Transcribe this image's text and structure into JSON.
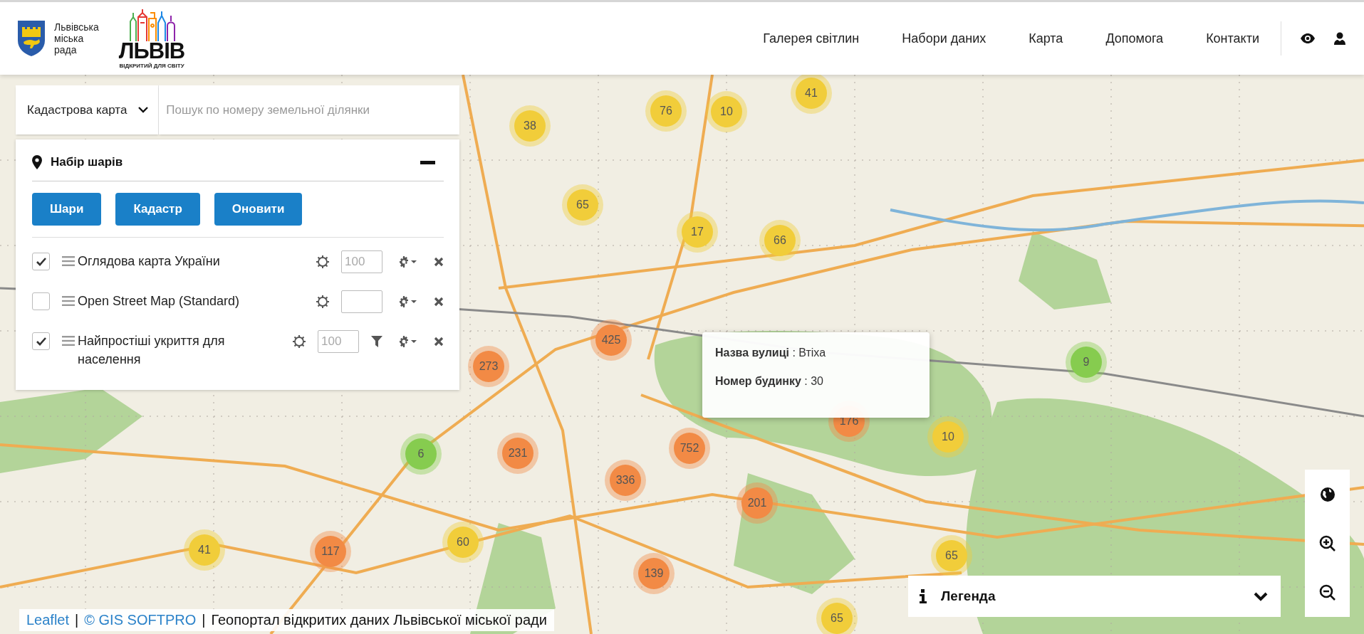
{
  "header": {
    "council": "Львівська міська рада",
    "brand": {
      "name": "ЛЬВІВ",
      "tagline": "ВІДКРИТИЙ ДЛЯ СВІТУ"
    },
    "nav": [
      "Галерея світлин",
      "Набори даних",
      "Карта",
      "Допомога",
      "Контакти"
    ]
  },
  "search": {
    "layer_select": "Кадастрова карта",
    "placeholder": "Пошук по номеру земельної ділянки"
  },
  "layers_panel": {
    "title": "Набір шарів",
    "buttons": [
      "Шари",
      "Кадастр",
      "Оновити"
    ],
    "layers": [
      {
        "name": "Оглядова карта України",
        "checked": true,
        "opacity": "100",
        "filter": false
      },
      {
        "name": "Open Street Map (Standard)",
        "checked": false,
        "filter": false
      },
      {
        "name": "Найпростіші укриття для населення",
        "checked": true,
        "opacity": "100",
        "filter": true
      }
    ]
  },
  "popup": {
    "fields": [
      "**Назва вулиці** : Втіха",
      "**Номер будинку** : 30"
    ]
  },
  "clusters": [
    {
      "count": "38",
      "color": "#f1cd3a"
    },
    {
      "count": "76",
      "color": "#f1cd3a"
    },
    {
      "count": "10",
      "color": "#f1cd3a"
    },
    {
      "count": "41",
      "color": "#f1cd3a"
    },
    {
      "count": "65",
      "color": "#f1cd3a"
    },
    {
      "count": "17",
      "color": "#f1cd3a"
    },
    {
      "count": "66",
      "color": "#f1cd3a"
    },
    {
      "count": "425",
      "color": "#f28a45"
    },
    {
      "count": "273",
      "color": "#f28a45"
    },
    {
      "count": "6",
      "color": "#86cc4f"
    },
    {
      "count": "231",
      "color": "#f28a45"
    },
    {
      "count": "752",
      "color": "#f28a45"
    },
    {
      "count": "336",
      "color": "#f28a45"
    },
    {
      "count": "201",
      "color": "#f28a45"
    },
    {
      "count": "176",
      "color": "#f28a45"
    },
    {
      "count": "10",
      "color": "#f1cd3a"
    },
    {
      "count": "9",
      "color": "#86cc4f"
    },
    {
      "count": "41",
      "color": "#f1cd3a"
    },
    {
      "count": "117",
      "color": "#f28a45"
    },
    {
      "count": "60",
      "color": "#f1cd3a"
    },
    {
      "count": "139",
      "color": "#f28a45"
    },
    {
      "count": "65",
      "color": "#f1cd3a"
    },
    {
      "count": "65",
      "color": "#f1cd3a"
    }
  ],
  "legend": {
    "title": "Легенда",
    "expanded": false
  },
  "attribution": [
    {
      "kind": "link",
      "text": "Leaflet"
    },
    {
      "kind": "separator",
      "text": "|"
    },
    {
      "kind": "link",
      "text": "© GIS SOFTPRO"
    },
    {
      "kind": "separator",
      "text": "|"
    },
    {
      "kind": "text",
      "text": "Геопортал відкритих даних Львівської міської ради"
    }
  ]
}
